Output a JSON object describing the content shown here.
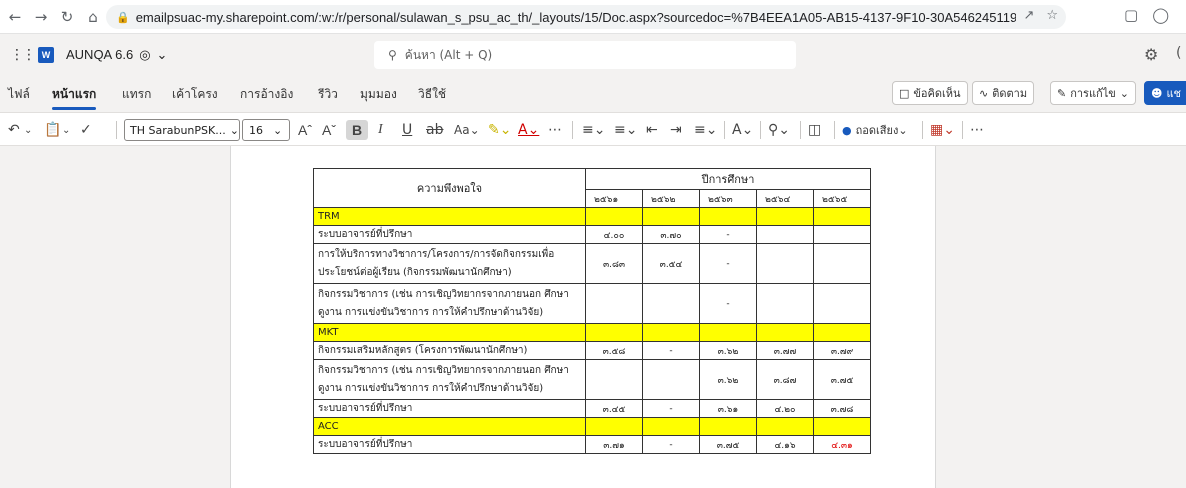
{
  "browser": {
    "url": "emailpsuac-my.sharepoint.com/:w:/r/personal/sulawan_s_psu_ac_th/_layouts/15/Doc.aspx?sourcedoc=%7B4EEA1A05-AB15-4137-9F10-30A546245119%7D&file=A..."
  },
  "app": {
    "doc_title": "AUNQA 6.6",
    "search_placeholder": "ค้นหา (Alt + Q)"
  },
  "ribbon": {
    "tabs": [
      "ไฟล์",
      "หน้าแรก",
      "แทรก",
      "เค้าโครง",
      "การอ้างอิง",
      "รีวิว",
      "มุมมอง",
      "วิธีใช้"
    ],
    "active_tab": "หน้าแรก",
    "comments_label": "ข้อคิดเห็น",
    "follow_label": "ติดตาม",
    "editing_label": "การแก้ไข",
    "share_label": "แช"
  },
  "toolbar": {
    "font_name": "TH SarabunPSK...",
    "font_size": "16",
    "dictate_label": "ถอดเสียง"
  },
  "table": {
    "header_item": "ความพึงพอใจ",
    "header_year_group": "ปีการศึกษา",
    "years": [
      "๒๕๖๑",
      "๒๕๖๒",
      "๒๕๖๓",
      "๒๕๖๔",
      "๒๕๖๕"
    ],
    "rows": [
      {
        "type": "category",
        "label": "TRM",
        "values": [
          "",
          "",
          "",
          "",
          ""
        ]
      },
      {
        "type": "item",
        "label": "ระบบอาจารย์ที่ปรึกษา",
        "values": [
          "๔.๐๐",
          "๓.๗๐",
          "-",
          "",
          ""
        ]
      },
      {
        "type": "item2",
        "label": "การให้บริการทางวิชาการ/โครงการ/การจัดกิจกรรมเพื่อ",
        "label2": "ประโยชน์ต่อผู้เรียน (กิจกรรมพัฒนานักศึกษา)",
        "values": [
          "๓.๘๓",
          "๓.๕๔",
          "-",
          "",
          ""
        ]
      },
      {
        "type": "item2",
        "label": "กิจกรรมวิชาการ (เช่น การเชิญวิทยากรจากภายนอก ศึกษา",
        "label2": "ดูงาน การแข่งขันวิชาการ การให้คำปรึกษาด้านวิจัย)",
        "values": [
          "",
          "",
          "-",
          "",
          ""
        ]
      },
      {
        "type": "category",
        "label": "MKT",
        "values": [
          "",
          "",
          "",
          "",
          ""
        ]
      },
      {
        "type": "item",
        "label": "กิจกรรมเสริมหลักสูตร (โครงการพัฒนานักศึกษา)",
        "values": [
          "๓.๕๘",
          "-",
          "๓.๖๒",
          "๓.๗๗",
          "๓.๗๙"
        ]
      },
      {
        "type": "item2",
        "label": "กิจกรรมวิชาการ (เช่น การเชิญวิทยากรจากภายนอก ศึกษา",
        "label2": "ดูงาน การแข่งขันวิชาการ การให้คำปรึกษาด้านวิจัย)",
        "values": [
          "",
          "",
          "๓.๖๒",
          "๓.๘๗",
          "๓.๗๕"
        ]
      },
      {
        "type": "item",
        "label": "ระบบอาจารย์ที่ปรึกษา",
        "values": [
          "๓.๔๕",
          "-",
          "๓.๖๑",
          "๔.๒๐",
          "๓.๗๘"
        ]
      },
      {
        "type": "category",
        "label": "ACC",
        "values": [
          "",
          "",
          "",
          "",
          ""
        ]
      },
      {
        "type": "item",
        "label": "ระบบอาจารย์ที่ปรึกษา",
        "values": [
          "๓.๗๑",
          "-",
          "๓.๗๕",
          "๔.๑๖",
          "๔.๓๑"
        ],
        "red_last": true
      }
    ]
  },
  "colors": {
    "accent": "#185abd",
    "category_fill": "#ffff00",
    "highlight_value": "#e00000"
  }
}
